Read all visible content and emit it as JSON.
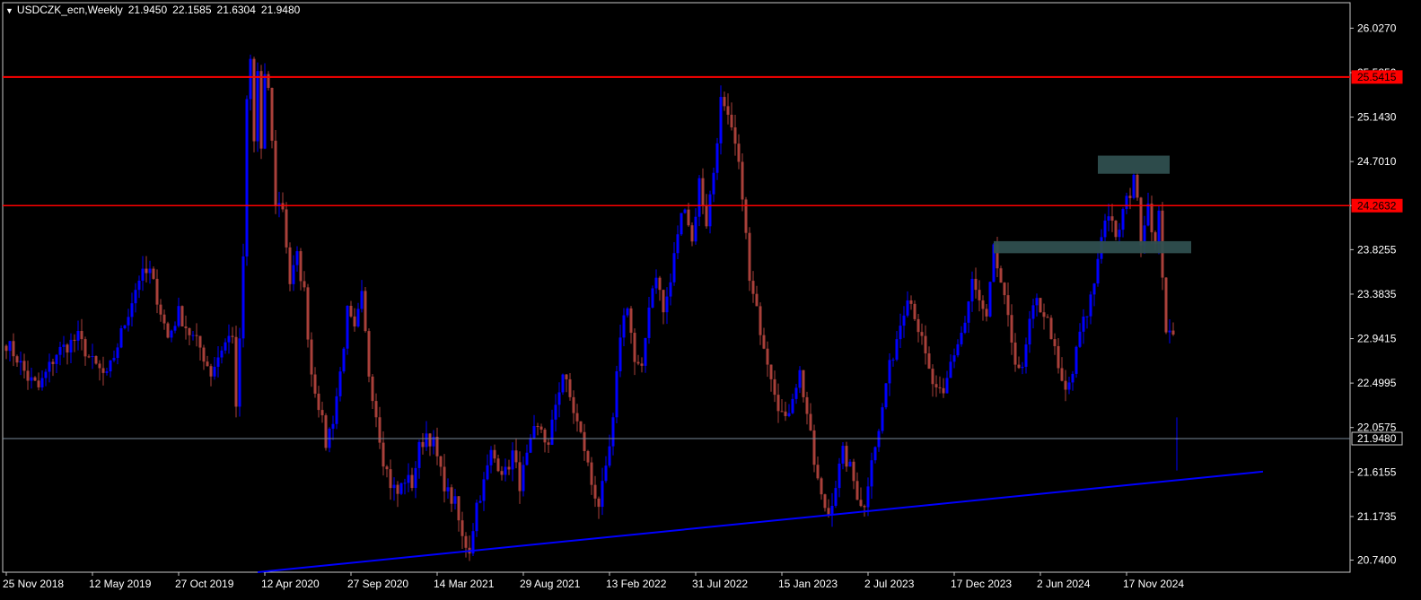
{
  "header": {
    "dropdown_icon": "triangle-down-icon",
    "symbol": "USDCZK_ecn,Weekly",
    "open": "21.9450",
    "high": "22.1585",
    "low": "21.6304",
    "close": "21.9480"
  },
  "colors": {
    "background": "#000000",
    "axis": "#c8c8c8",
    "bull": "#0000ff",
    "bear": "#a9403a",
    "resistance": "#ff0000",
    "trendline": "#0000ff",
    "zone": "#2f4f4f",
    "price_line": "#778899"
  },
  "chart_data": {
    "type": "candlestick",
    "timeframe": "Weekly",
    "ylim": [
      20.62,
      26.28
    ],
    "y_ticks": [
      "26.0270",
      "25.5850",
      "25.1430",
      "24.7010",
      "24.2632",
      "23.8255",
      "23.3835",
      "22.9415",
      "22.4995",
      "22.0575",
      "21.6155",
      "21.1735",
      "20.7400"
    ],
    "x_ticks": [
      {
        "label": "25 Nov 2018",
        "index": 0
      },
      {
        "label": "12 May 2019",
        "index": 24
      },
      {
        "label": "27 Oct 2019",
        "index": 48
      },
      {
        "label": "12 Apr 2020",
        "index": 72
      },
      {
        "label": "27 Sep 2020",
        "index": 96
      },
      {
        "label": "14 Mar 2021",
        "index": 120
      },
      {
        "label": "29 Aug 2021",
        "index": 144
      },
      {
        "label": "13 Feb 2022",
        "index": 168
      },
      {
        "label": "31 Jul 2022",
        "index": 192
      },
      {
        "label": "15 Jan 2023",
        "index": 216
      },
      {
        "label": "2 Jul 2023",
        "index": 240
      },
      {
        "label": "17 Dec 2023",
        "index": 264
      },
      {
        "label": "2 Jun 2024",
        "index": 288
      },
      {
        "label": "17 Nov 2024",
        "index": 312
      }
    ],
    "bar_count": 327,
    "close_path": [
      [
        0,
        22.9
      ],
      [
        3,
        22.75
      ],
      [
        6,
        22.55
      ],
      [
        9,
        22.45
      ],
      [
        14,
        22.8
      ],
      [
        20,
        22.95
      ],
      [
        24,
        22.7
      ],
      [
        28,
        22.55
      ],
      [
        33,
        23.1
      ],
      [
        37,
        23.55
      ],
      [
        40,
        23.6
      ],
      [
        42,
        23.35
      ],
      [
        45,
        22.95
      ],
      [
        48,
        23.2
      ],
      [
        51,
        23.0
      ],
      [
        54,
        22.85
      ],
      [
        57,
        22.6
      ],
      [
        60,
        22.85
      ],
      [
        63,
        23.0
      ],
      [
        64,
        22.2
      ],
      [
        66,
        23.7
      ],
      [
        67,
        25.3
      ],
      [
        68,
        25.7
      ],
      [
        69,
        24.9
      ],
      [
        70,
        25.6
      ],
      [
        71,
        24.8
      ],
      [
        72,
        25.5
      ],
      [
        73,
        25.45
      ],
      [
        75,
        24.3
      ],
      [
        77,
        24.25
      ],
      [
        79,
        23.5
      ],
      [
        81,
        23.75
      ],
      [
        83,
        23.4
      ],
      [
        85,
        22.6
      ],
      [
        87,
        22.3
      ],
      [
        89,
        21.9
      ],
      [
        91,
        22.15
      ],
      [
        93,
        22.6
      ],
      [
        95,
        23.2
      ],
      [
        97,
        23.0
      ],
      [
        99,
        23.35
      ],
      [
        101,
        22.6
      ],
      [
        103,
        22.2
      ],
      [
        105,
        21.75
      ],
      [
        107,
        21.5
      ],
      [
        109,
        21.4
      ],
      [
        111,
        21.55
      ],
      [
        113,
        21.5
      ],
      [
        115,
        21.85
      ],
      [
        117,
        22.0
      ],
      [
        119,
        21.9
      ],
      [
        121,
        21.6
      ],
      [
        123,
        21.4
      ],
      [
        125,
        21.3
      ],
      [
        127,
        20.95
      ],
      [
        129,
        20.85
      ],
      [
        131,
        21.3
      ],
      [
        133,
        21.5
      ],
      [
        135,
        21.8
      ],
      [
        137,
        21.7
      ],
      [
        139,
        21.6
      ],
      [
        141,
        21.8
      ],
      [
        143,
        21.5
      ],
      [
        145,
        21.75
      ],
      [
        147,
        22.0
      ],
      [
        149,
        22.05
      ],
      [
        151,
        21.85
      ],
      [
        153,
        22.3
      ],
      [
        155,
        22.6
      ],
      [
        157,
        22.35
      ],
      [
        159,
        22.1
      ],
      [
        161,
        21.85
      ],
      [
        163,
        21.5
      ],
      [
        165,
        21.3
      ],
      [
        167,
        21.6
      ],
      [
        169,
        22.1
      ],
      [
        171,
        23.0
      ],
      [
        173,
        23.3
      ],
      [
        175,
        22.7
      ],
      [
        177,
        22.6
      ],
      [
        179,
        23.3
      ],
      [
        181,
        23.6
      ],
      [
        183,
        23.2
      ],
      [
        185,
        23.5
      ],
      [
        187,
        24.0
      ],
      [
        189,
        24.3
      ],
      [
        191,
        23.9
      ],
      [
        193,
        24.5
      ],
      [
        195,
        24.1
      ],
      [
        197,
        24.6
      ],
      [
        199,
        25.3
      ],
      [
        201,
        25.1
      ],
      [
        203,
        24.85
      ],
      [
        205,
        24.4
      ],
      [
        207,
        23.5
      ],
      [
        209,
        23.2
      ],
      [
        211,
        22.9
      ],
      [
        213,
        22.6
      ],
      [
        215,
        22.3
      ],
      [
        217,
        22.1
      ],
      [
        219,
        22.4
      ],
      [
        221,
        22.6
      ],
      [
        223,
        22.2
      ],
      [
        225,
        21.7
      ],
      [
        227,
        21.35
      ],
      [
        229,
        21.2
      ],
      [
        231,
        21.5
      ],
      [
        233,
        21.8
      ],
      [
        235,
        21.65
      ],
      [
        237,
        21.4
      ],
      [
        239,
        21.25
      ],
      [
        241,
        21.8
      ],
      [
        243,
        22.0
      ],
      [
        245,
        22.5
      ],
      [
        247,
        22.8
      ],
      [
        249,
        23.1
      ],
      [
        251,
        23.4
      ],
      [
        253,
        23.2
      ],
      [
        255,
        22.9
      ],
      [
        257,
        22.6
      ],
      [
        259,
        22.4
      ],
      [
        261,
        22.35
      ],
      [
        263,
        22.7
      ],
      [
        265,
        22.9
      ],
      [
        267,
        23.1
      ],
      [
        269,
        23.5
      ],
      [
        271,
        23.3
      ],
      [
        273,
        23.1
      ],
      [
        275,
        23.8
      ],
      [
        277,
        23.5
      ],
      [
        279,
        23.1
      ],
      [
        281,
        22.75
      ],
      [
        283,
        22.6
      ],
      [
        285,
        23.1
      ],
      [
        287,
        23.3
      ],
      [
        289,
        23.2
      ],
      [
        291,
        23.0
      ],
      [
        293,
        22.6
      ],
      [
        295,
        22.4
      ],
      [
        297,
        22.6
      ],
      [
        299,
        23.0
      ],
      [
        301,
        23.2
      ],
      [
        303,
        23.5
      ],
      [
        305,
        24.0
      ],
      [
        307,
        24.2
      ],
      [
        309,
        23.9
      ],
      [
        311,
        24.2
      ],
      [
        313,
        24.4
      ],
      [
        314,
        24.6
      ],
      [
        316,
        23.95
      ],
      [
        318,
        24.3
      ],
      [
        320,
        23.85
      ],
      [
        321,
        24.15
      ],
      [
        322,
        23.6
      ],
      [
        323,
        23.05
      ],
      [
        324,
        22.95
      ],
      [
        325,
        22.95
      ],
      [
        326,
        21.948
      ]
    ],
    "horizontal_lines": [
      {
        "price": 25.5415,
        "label": "25.5415",
        "color": "#ff0000",
        "width": 2
      },
      {
        "price": 24.2632,
        "label": "24.2632",
        "color": "#ff0000",
        "width": 1.5
      },
      {
        "price": 21.948,
        "label": "21.9480",
        "color": "#778899",
        "width": 1
      }
    ],
    "trendline": {
      "from": [
        70,
        20.62
      ],
      "to": [
        350,
        21.62
      ],
      "color": "#0000ff"
    },
    "zones": [
      {
        "from_index": 304,
        "to_index": 324,
        "y_top": 24.76,
        "y_bottom": 24.58
      },
      {
        "from_index": 275,
        "to_index": 330,
        "y_top": 23.91,
        "y_bottom": 23.79
      }
    ],
    "last_bar": {
      "open": 21.945,
      "high": 22.1585,
      "low": 21.6304,
      "close": 21.948
    }
  }
}
